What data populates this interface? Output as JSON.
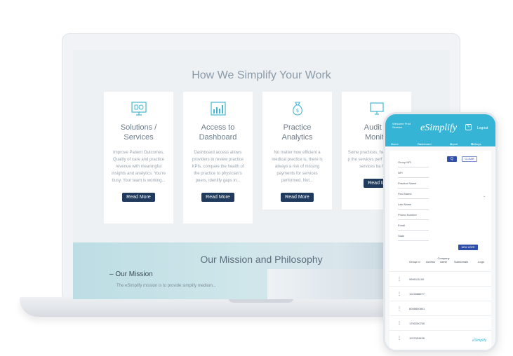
{
  "laptop": {
    "section_title": "How We Simplify Your Work",
    "cards": [
      {
        "title_l1": "Solutions /",
        "title_l2": "Services",
        "text": "Improve Patient Outcomes, Quality of care and practice revenue with meaningful insights and analytics. You're busy. Your team is working...",
        "button": "Read More",
        "icon": "presentation-chart-icon"
      },
      {
        "title_l1": "Access to",
        "title_l2": "Dashboard",
        "text": "Dashboard access allows providers to review practice KPIs, compare the health of the practice to physician's peers, identify gaps in...",
        "button": "Read More",
        "icon": "bar-chart-icon"
      },
      {
        "title_l1": "Practice",
        "title_l2": "Analytics",
        "text": "No matter how efficient a medical practice is, there is always a risk of missing payments for services performed. Not...",
        "button": "Read More",
        "icon": "money-bag-icon"
      },
      {
        "title_l1": "Audit P",
        "title_l2": "Monito",
        "text": "Some practices, hesitant to bill p the services perf consistently services ba higher",
        "button": "Read M",
        "icon": "monitor-icon"
      }
    ],
    "mission": {
      "title": "Our Mission and Philosophy",
      "subtitle": "Our Mission",
      "line": "The eSimplify mission is to provide simplify medium..."
    }
  },
  "phone": {
    "welcome": "Welcome Prod Session",
    "logo": "eSimplify",
    "logout": "Logout",
    "nav": [
      "Home",
      "Dashboard",
      "Import Data",
      "Settings"
    ],
    "search_label": "Q",
    "clear_label": "CLEAR",
    "fields": [
      "Group NPI",
      "NPI",
      "Practice Name",
      "First Name",
      "Last Name",
      "Phone Number",
      "Email",
      "State"
    ],
    "new_user": "NEW USER",
    "columns": [
      "Group Id",
      "Access",
      "Company name",
      "Subdomain",
      "Logo"
    ],
    "rows": [
      "9999111100",
      "1122888677",
      "8008800801",
      "1700200700",
      "1122334455"
    ],
    "footer_logo": "eSimplify"
  }
}
